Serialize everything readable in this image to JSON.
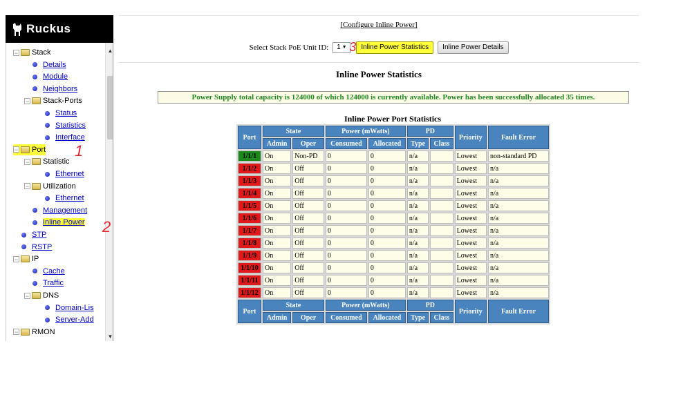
{
  "brand": {
    "name": "Ruckus"
  },
  "nav": {
    "items": [
      {
        "id": "stack",
        "label": "Stack",
        "type": "folder",
        "level": 0,
        "link": false
      },
      {
        "id": "details",
        "label": "Details",
        "type": "leaf",
        "level": 1,
        "link": true
      },
      {
        "id": "module",
        "label": "Module",
        "type": "leaf",
        "level": 1,
        "link": true
      },
      {
        "id": "neighbors",
        "label": "Neighbors",
        "type": "leaf",
        "level": 1,
        "link": true
      },
      {
        "id": "stack-ports",
        "label": "Stack-Ports",
        "type": "folder",
        "level": 1,
        "link": false
      },
      {
        "id": "status",
        "label": "Status",
        "type": "leaf",
        "level": 2,
        "link": true
      },
      {
        "id": "statistics",
        "label": "Statistics",
        "type": "leaf",
        "level": 2,
        "link": true
      },
      {
        "id": "interface",
        "label": "Interface",
        "type": "leaf",
        "level": 2,
        "link": true
      },
      {
        "id": "port",
        "label": "Port",
        "type": "folder",
        "level": 0,
        "link": false,
        "highlight": true
      },
      {
        "id": "statistic",
        "label": "Statistic",
        "type": "folder",
        "level": 1,
        "link": false
      },
      {
        "id": "ethernet-1",
        "label": "Ethernet",
        "type": "leaf",
        "level": 2,
        "link": true
      },
      {
        "id": "utilization",
        "label": "Utilization",
        "type": "folder",
        "level": 1,
        "link": false
      },
      {
        "id": "ethernet-2",
        "label": "Ethernet",
        "type": "leaf",
        "level": 2,
        "link": true
      },
      {
        "id": "management",
        "label": "Management",
        "type": "leaf",
        "level": 1,
        "link": true
      },
      {
        "id": "inline-power",
        "label": "Inline Power",
        "type": "leaf",
        "level": 1,
        "link": true,
        "highlight": true
      },
      {
        "id": "stp",
        "label": "STP",
        "type": "leaf",
        "level": 0,
        "link": true
      },
      {
        "id": "rstp",
        "label": "RSTP",
        "type": "leaf",
        "level": 0,
        "link": true
      },
      {
        "id": "ip",
        "label": "IP",
        "type": "folder",
        "level": 0,
        "link": false
      },
      {
        "id": "cache",
        "label": "Cache",
        "type": "leaf",
        "level": 1,
        "link": true
      },
      {
        "id": "traffic",
        "label": "Traffic",
        "type": "leaf",
        "level": 1,
        "link": true
      },
      {
        "id": "dns",
        "label": "DNS",
        "type": "folder",
        "level": 1,
        "link": false
      },
      {
        "id": "domain-list",
        "label": "Domain-Lis",
        "type": "leaf",
        "level": 2,
        "link": true
      },
      {
        "id": "server-address",
        "label": "Server-Add",
        "type": "leaf",
        "level": 2,
        "link": true
      },
      {
        "id": "rmon",
        "label": "RMON",
        "type": "folder",
        "level": 0,
        "link": false
      }
    ],
    "annotations": [
      "1",
      "2"
    ]
  },
  "main": {
    "configure_link": "[Configure Inline Power]",
    "unit_label": "Select Stack PoE Unit ID:",
    "unit_value": "1",
    "annotation": "3",
    "stats_button": "Inline Power Statistics",
    "details_button": "Inline Power Details",
    "page_title": "Inline Power Statistics",
    "banner": "Power Supply total capacity is 124000 of which 124000 is currently available. Power has been successfully allocated 35 times.",
    "table_title": "Inline Power Port Statistics"
  },
  "table": {
    "headers": {
      "port": "Port",
      "state": "State",
      "power": "Power (mWatts)",
      "pd": "PD",
      "priority": "Priority",
      "fault": "Fault Error",
      "admin": "Admin",
      "oper": "Oper",
      "consumed": "Consumed",
      "allocated": "Allocated",
      "type": "Type",
      "class": "Class"
    },
    "rows": [
      {
        "port": "1/1/1",
        "admin": "On",
        "oper": "Non-PD",
        "consumed": "0",
        "allocated": "0",
        "type": "n/a",
        "class": "",
        "priority": "Lowest",
        "fault": "non-standard PD",
        "status_color": "#1a8a1a"
      },
      {
        "port": "1/1/2",
        "admin": "On",
        "oper": "Off",
        "consumed": "0",
        "allocated": "0",
        "type": "n/a",
        "class": "",
        "priority": "Lowest",
        "fault": "n/a",
        "status_color": "#e01a1a"
      },
      {
        "port": "1/1/3",
        "admin": "On",
        "oper": "Off",
        "consumed": "0",
        "allocated": "0",
        "type": "n/a",
        "class": "",
        "priority": "Lowest",
        "fault": "n/a",
        "status_color": "#e01a1a"
      },
      {
        "port": "1/1/4",
        "admin": "On",
        "oper": "Off",
        "consumed": "0",
        "allocated": "0",
        "type": "n/a",
        "class": "",
        "priority": "Lowest",
        "fault": "n/a",
        "status_color": "#e01a1a"
      },
      {
        "port": "1/1/5",
        "admin": "On",
        "oper": "Off",
        "consumed": "0",
        "allocated": "0",
        "type": "n/a",
        "class": "",
        "priority": "Lowest",
        "fault": "n/a",
        "status_color": "#e01a1a"
      },
      {
        "port": "1/1/6",
        "admin": "On",
        "oper": "Off",
        "consumed": "0",
        "allocated": "0",
        "type": "n/a",
        "class": "",
        "priority": "Lowest",
        "fault": "n/a",
        "status_color": "#e01a1a"
      },
      {
        "port": "1/1/7",
        "admin": "On",
        "oper": "Off",
        "consumed": "0",
        "allocated": "0",
        "type": "n/a",
        "class": "",
        "priority": "Lowest",
        "fault": "n/a",
        "status_color": "#e01a1a"
      },
      {
        "port": "1/1/8",
        "admin": "On",
        "oper": "Off",
        "consumed": "0",
        "allocated": "0",
        "type": "n/a",
        "class": "",
        "priority": "Lowest",
        "fault": "n/a",
        "status_color": "#e01a1a"
      },
      {
        "port": "1/1/9",
        "admin": "On",
        "oper": "Off",
        "consumed": "0",
        "allocated": "0",
        "type": "n/a",
        "class": "",
        "priority": "Lowest",
        "fault": "n/a",
        "status_color": "#e01a1a"
      },
      {
        "port": "1/1/10",
        "admin": "On",
        "oper": "Off",
        "consumed": "0",
        "allocated": "0",
        "type": "n/a",
        "class": "",
        "priority": "Lowest",
        "fault": "n/a",
        "status_color": "#e01a1a"
      },
      {
        "port": "1/1/11",
        "admin": "On",
        "oper": "Off",
        "consumed": "0",
        "allocated": "0",
        "type": "n/a",
        "class": "",
        "priority": "Lowest",
        "fault": "n/a",
        "status_color": "#e01a1a"
      },
      {
        "port": "1/1/12",
        "admin": "On",
        "oper": "Off",
        "consumed": "0",
        "allocated": "0",
        "type": "n/a",
        "class": "",
        "priority": "Lowest",
        "fault": "n/a",
        "status_color": "#e01a1a"
      }
    ]
  }
}
